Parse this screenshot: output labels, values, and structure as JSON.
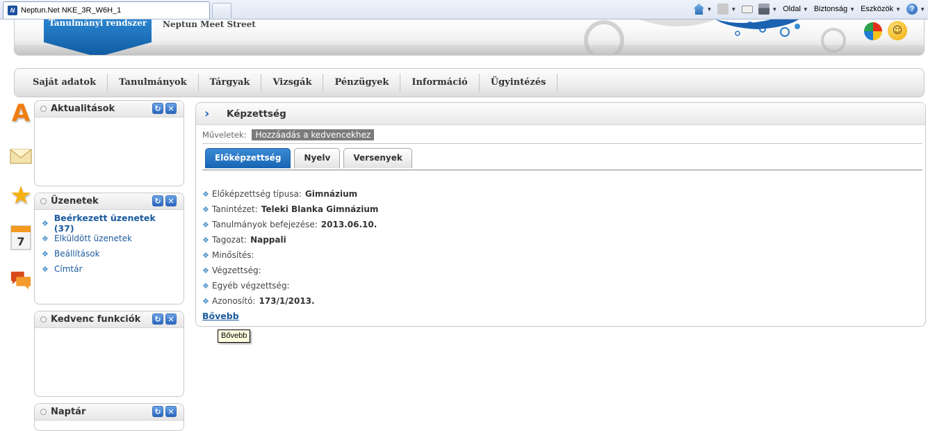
{
  "browser": {
    "tab_title": "Neptun.Net NKE_3R_W6H_1",
    "favicon_text": "N",
    "commands": [
      {
        "name": "home",
        "label": ""
      },
      {
        "name": "feeds",
        "label": ""
      },
      {
        "name": "mail",
        "label": ""
      },
      {
        "name": "print",
        "label": ""
      },
      {
        "name": "page",
        "label": "Oldal"
      },
      {
        "name": "safety",
        "label": "Biztonság"
      },
      {
        "name": "tools",
        "label": "Eszközök"
      },
      {
        "name": "help",
        "label": ""
      }
    ]
  },
  "header": {
    "badge_text": "Tanulmányi rendszer",
    "subtitle": "Neptun Meet Street"
  },
  "menu": {
    "items": [
      "Saját adatok",
      "Tanulmányok",
      "Tárgyak",
      "Vizsgák",
      "Pénzügyek",
      "Információ",
      "Ügyintézés"
    ]
  },
  "panels": {
    "news": {
      "title": "Aktualitások"
    },
    "messages": {
      "title": "Üzenetek",
      "links": [
        "Beérkezett üzenetek (37)",
        "Elküldött üzenetek",
        "Beállítások",
        "Címtár"
      ]
    },
    "favorites": {
      "title": "Kedvenc funkciók"
    },
    "calendar": {
      "title": "Naptár"
    }
  },
  "content": {
    "title": "Képzettség",
    "ops_label": "Műveletek:",
    "ops_action": "Hozzáadás a kedvencekhez",
    "tabs": [
      "Előképzettség",
      "Nyelv",
      "Versenyek"
    ],
    "active_tab": "Előképzettség",
    "fields": [
      {
        "label": "Előképzettség típusa:",
        "value": "Gimnázium"
      },
      {
        "label": "Tanintézet:",
        "value": "Teleki Blanka Gimnázium"
      },
      {
        "label": "Tanulmányok befejezése:",
        "value": "2013.06.10."
      },
      {
        "label": "Tagozat:",
        "value": "Nappali"
      },
      {
        "label": "Minősítés:",
        "value": ""
      },
      {
        "label": "Végzettség:",
        "value": ""
      },
      {
        "label": "Egyéb végzettség:",
        "value": ""
      },
      {
        "label": "Azonosító:",
        "value": "173/1/2013."
      }
    ],
    "more_link": "Bővebb"
  },
  "tooltip": {
    "text": "Bővebb"
  },
  "colors": {
    "accent_blue": "#1765b3",
    "link_blue": "#1b5a9e",
    "ops_bg": "#7b7b7b",
    "tooltip_bg": "#ffffe1"
  }
}
